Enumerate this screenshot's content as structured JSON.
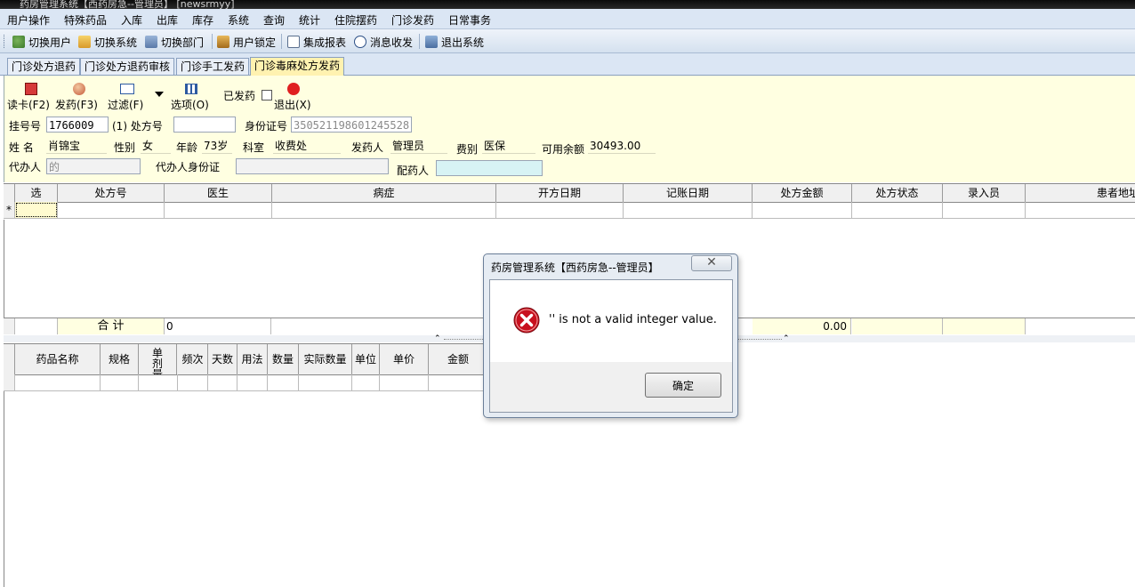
{
  "window": {
    "title": "药房管理系统【西药房急--管理员】  [newsrmyy]"
  },
  "menu": [
    "用户操作",
    "特殊药品",
    "入库",
    "出库",
    "库存",
    "系统",
    "查询",
    "统计",
    "住院摆药",
    "门诊发药",
    "日常事务"
  ],
  "toolbar": {
    "switch_user": "切换用户",
    "switch_system": "切换系统",
    "switch_dept": "切换部门",
    "user_lock": "用户锁定",
    "reports": "集成报表",
    "messages": "消息收发",
    "exit": "退出系统"
  },
  "tabs": [
    "门诊处方退药",
    "门诊处方退药审核",
    "门诊手工发药",
    "门诊毒麻处方发药"
  ],
  "actions": {
    "read_card": "读卡(F2)",
    "dispense": "发药(F3)",
    "filter": "过滤(F)",
    "options": "选项(O)",
    "dispensed_label": "已发药",
    "exit": "退出(X)"
  },
  "form": {
    "reg_no_label": "挂号号",
    "reg_no": "1766009",
    "rx_label": "(1) 处方号",
    "rx_no": "",
    "id_label": "身份证号",
    "id_no": "350521198601245528",
    "name_label": "姓  名",
    "name": "肖锦宝",
    "sex_label": "性别",
    "sex": "女",
    "age_label": "年龄",
    "age": "73岁",
    "dept_label": "科室",
    "dept": "收费处",
    "dispenser_label": "发药人",
    "dispenser": "管理员",
    "fee_label": "费别",
    "fee": "医保",
    "balance_label": "可用余额",
    "balance": "30493.00",
    "agent_label": "代办人",
    "agent": "的",
    "agent_id_label": "代办人身份证",
    "agent_id": "",
    "pharmacist_label": "配药人",
    "pharmacist": ""
  },
  "rx_grid": {
    "headers": [
      "选",
      "处方号",
      "医生",
      "病症",
      "开方日期",
      "记账日期",
      "处方金额",
      "处方状态",
      "录入员",
      "患者地址"
    ],
    "new_row_marker": "*",
    "total_label": "合  计",
    "total_count": "0",
    "total_amount": "0.00"
  },
  "drug_grid": {
    "headers": [
      "药品名称",
      "规格",
      "单剂量",
      "频次",
      "天数",
      "用法",
      "数量",
      "实际数量",
      "单位",
      "单价",
      "金额"
    ]
  },
  "dialog": {
    "title": "药房管理系统【西药房急--管理员】",
    "close": "✕",
    "message": "'' is not a valid integer value.",
    "ok": "确定"
  }
}
